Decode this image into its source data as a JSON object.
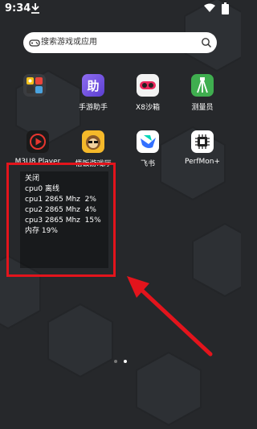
{
  "status_bar": {
    "time": "9:34"
  },
  "search": {
    "placeholder": "搜索游戏或应用"
  },
  "apps_row1": [
    {
      "name": "",
      "icon": "app-folder-icon"
    },
    {
      "name": "手游助手",
      "icon": "shouyou-assistant-icon"
    },
    {
      "name": "X8沙箱",
      "icon": "x8-sandbox-icon"
    },
    {
      "name": "测量员",
      "icon": "surveyor-icon"
    }
  ],
  "apps_row2": [
    {
      "name": "M3U8 Player",
      "icon": "m3u8-player-icon"
    },
    {
      "name": "悟饭游戏厅",
      "icon": "wufan-game-hall-icon"
    },
    {
      "name": "飞书",
      "icon": "feishu-icon"
    },
    {
      "name": "PerfMon+",
      "icon": "perfmon-chip-icon"
    }
  ],
  "perf_overlay": {
    "close": "关闭",
    "cpu0": "cpu0 离线",
    "cpu1": "cpu1 2865 Mhz  2%",
    "cpu2": "cpu2 2865 Mhz  4%",
    "cpu3": "cpu3 2865 Mhz  15%",
    "memory": "内存 19%"
  },
  "page_indicator": {
    "pages": 2,
    "current": 2
  },
  "colors": {
    "highlight": "#e3141c",
    "background": "#26282b"
  }
}
